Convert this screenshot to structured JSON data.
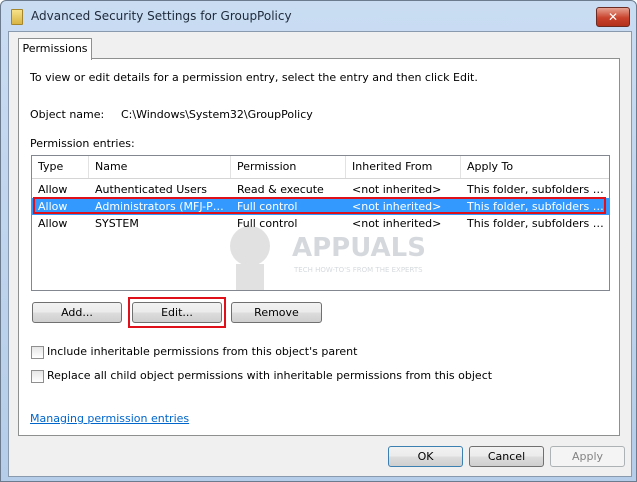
{
  "window": {
    "title": "Advanced Security Settings for GroupPolicy",
    "close_glyph": "✕"
  },
  "tabs": [
    {
      "label": "Permissions",
      "selected": true
    }
  ],
  "instructions": "To view or edit details for a permission entry, select the entry and then click Edit.",
  "object_name": {
    "label": "Object name:",
    "value": "C:\\Windows\\System32\\GroupPolicy"
  },
  "permission_entries": {
    "label": "Permission entries:",
    "columns": [
      "Type",
      "Name",
      "Permission",
      "Inherited From",
      "Apply To"
    ],
    "rows": [
      {
        "type": "Allow",
        "name": "Authenticated Users",
        "permission": "Read & execute",
        "inherited_from": "<not inherited>",
        "apply_to": "This folder, subfolders and files",
        "selected": false
      },
      {
        "type": "Allow",
        "name": "Administrators (MFJ-PC\\Administrators)",
        "permission": "Full control",
        "inherited_from": "<not inherited>",
        "apply_to": "This folder, subfolders and files",
        "selected": true
      },
      {
        "type": "Allow",
        "name": "SYSTEM",
        "permission": "Full control",
        "inherited_from": "<not inherited>",
        "apply_to": "This folder, subfolders and files",
        "selected": false
      }
    ]
  },
  "buttons": {
    "add": "Add...",
    "edit": "Edit...",
    "remove": "Remove"
  },
  "checkboxes": {
    "include_inheritable": {
      "label": "Include inheritable permissions from this object's parent",
      "checked": false
    },
    "replace_child": {
      "label": "Replace all child object permissions with inheritable permissions from this object",
      "checked": false
    }
  },
  "help_link": "Managing permission entries",
  "footer": {
    "ok": "OK",
    "cancel": "Cancel",
    "apply": "Apply"
  },
  "watermark": {
    "brand": "APPUALS",
    "tagline": "TECH HOW-TO'S FROM THE EXPERTS"
  },
  "colors": {
    "selection": "#3399ff",
    "highlight_annotation": "#e0101a",
    "link": "#0066cc"
  }
}
